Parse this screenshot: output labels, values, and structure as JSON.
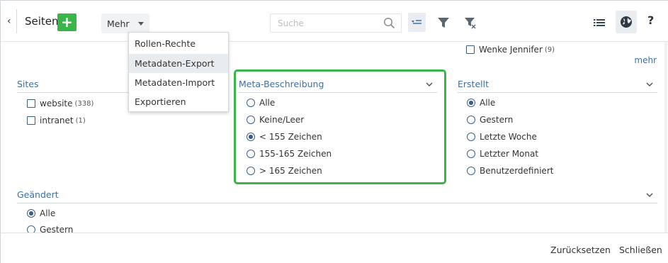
{
  "toolbar": {
    "back_symbol": "‹",
    "title": "Seiten",
    "add_symbol": "+",
    "mehr_label": "Mehr",
    "search_placeholder": "Suche",
    "help_symbol": "?"
  },
  "menu": {
    "items": [
      {
        "label": "Rollen-Rechte"
      },
      {
        "label": "Metadaten-Export"
      },
      {
        "label": "Metadaten-Import"
      },
      {
        "label": "Exportieren"
      }
    ]
  },
  "top_right": {
    "checkbox_label": "Wenke Jennifer",
    "checkbox_count": "(9)",
    "more_link": "mehr"
  },
  "sites": {
    "title": "Sites",
    "items": [
      {
        "label": "website",
        "count": "(338)"
      },
      {
        "label": "intranet",
        "count": "(1)"
      }
    ]
  },
  "meta_beschreibung": {
    "title": "Meta-Beschreibung",
    "options": [
      {
        "label": "Alle",
        "checked": false
      },
      {
        "label": "Keine/Leer",
        "checked": false
      },
      {
        "label": "< 155 Zeichen",
        "checked": true
      },
      {
        "label": "155-165 Zeichen",
        "checked": false
      },
      {
        "label": "> 165 Zeichen",
        "checked": false
      }
    ]
  },
  "erstellt": {
    "title": "Erstellt",
    "options": [
      {
        "label": "Alle",
        "checked": true
      },
      {
        "label": "Gestern",
        "checked": false
      },
      {
        "label": "Letzte Woche",
        "checked": false
      },
      {
        "label": "Letzter Monat",
        "checked": false
      },
      {
        "label": "Benutzerdefiniert",
        "checked": false
      }
    ]
  },
  "geaendert": {
    "title": "Geändert",
    "options": [
      {
        "label": "Alle",
        "checked": true
      },
      {
        "label": "Gestern",
        "checked": false
      }
    ]
  },
  "footer": {
    "reset_label": "Zurücksetzen",
    "close_label": "Schließen"
  },
  "colors": {
    "accent_green": "#3ab54a",
    "link_blue": "#3d6fa3",
    "control_blue": "#3b5f88"
  }
}
